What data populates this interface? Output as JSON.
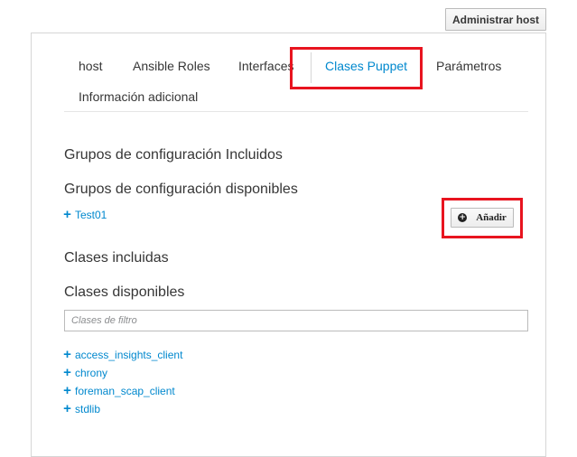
{
  "header": {
    "manage_host_label": "Administrar host"
  },
  "tabs": [
    {
      "label": "host",
      "active": false
    },
    {
      "label": "Ansible Roles",
      "active": false
    },
    {
      "label": "Interfaces",
      "active": false
    },
    {
      "label": "Clases Puppet",
      "active": true
    },
    {
      "label": "Parámetros",
      "active": false
    },
    {
      "label": "Información adicional",
      "active": false
    }
  ],
  "config_groups": {
    "included_heading": "Grupos de configuración Incluidos",
    "available_heading": "Grupos de configuración disponibles",
    "available_items": [
      {
        "label": "Test01"
      }
    ],
    "add_button_label": "Añadir"
  },
  "classes": {
    "included_heading": "Clases incluidas",
    "available_heading": "Clases disponibles",
    "filter_placeholder": "Clases de filtro",
    "available_items": [
      {
        "label": "access_insights_client"
      },
      {
        "label": "chrony"
      },
      {
        "label": "foreman_scap_client"
      },
      {
        "label": "stdlib"
      }
    ]
  },
  "colors": {
    "link": "#0088ce",
    "highlight": "#e8141f",
    "text": "#363636"
  },
  "icons": {
    "expand": "plus-icon",
    "add": "plus-circle-icon"
  }
}
